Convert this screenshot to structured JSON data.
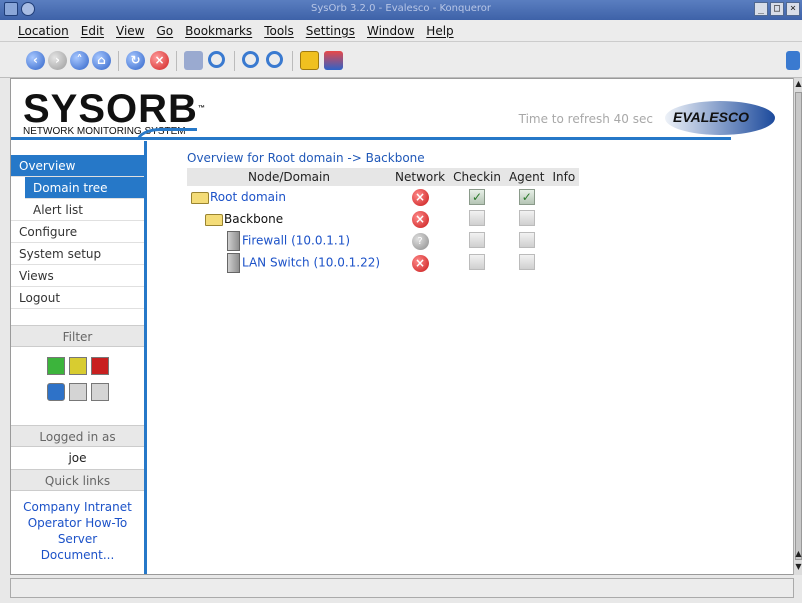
{
  "window": {
    "title": "SysOrb 3.2.0 - Evalesco - Konqueror",
    "buttons": [
      "_",
      "□",
      "×"
    ]
  },
  "menu": [
    "Location",
    "Edit",
    "View",
    "Go",
    "Bookmarks",
    "Tools",
    "Settings",
    "Window",
    "Help"
  ],
  "toolbar": {
    "icons": [
      "back-icon",
      "forward-icon",
      "up-icon",
      "home-icon",
      "reload-icon",
      "stop-icon",
      "print-icon",
      "find-icon",
      "zoom-in-icon",
      "zoom-out-icon",
      "lock-icon",
      "download-icon"
    ]
  },
  "header": {
    "logo_word": "SYSORB",
    "logo_tm": "™",
    "logo_sub": "NETWORK MONITORING SYSTEM",
    "refresh": "Time to refresh 40 sec",
    "brand": "EVALESCO"
  },
  "sidebar": {
    "nav": {
      "overview": "Overview",
      "domain_tree": "Domain tree",
      "alert_list": "Alert list",
      "configure": "Configure",
      "system_setup": "System setup",
      "views": "Views",
      "logout": "Logout"
    },
    "filter_label": "Filter",
    "logged_label": "Logged in as",
    "user": "joe",
    "quick_label": "Quick links",
    "links": [
      "Company Intranet",
      "Operator How-To",
      "Server",
      "Document..."
    ]
  },
  "content": {
    "breadcrumb": "Overview for Root domain -> Backbone",
    "columns": [
      "Node/Domain",
      "Network",
      "Checkin",
      "Agent",
      "Info"
    ],
    "rows": [
      {
        "name": "Root domain",
        "network": "error",
        "checkin": "ok",
        "agent": "ok"
      },
      {
        "name": "Backbone",
        "network": "error",
        "checkin": "none",
        "agent": "none"
      },
      {
        "name": "Firewall (10.0.1.1)",
        "network": "unknown",
        "checkin": "none",
        "agent": "none"
      },
      {
        "name": "LAN Switch (10.0.1.22)",
        "network": "error",
        "checkin": "none",
        "agent": "none"
      }
    ]
  },
  "colors": {
    "accent": "#2678c8",
    "link": "#1c52c8",
    "error": "#c81818"
  }
}
